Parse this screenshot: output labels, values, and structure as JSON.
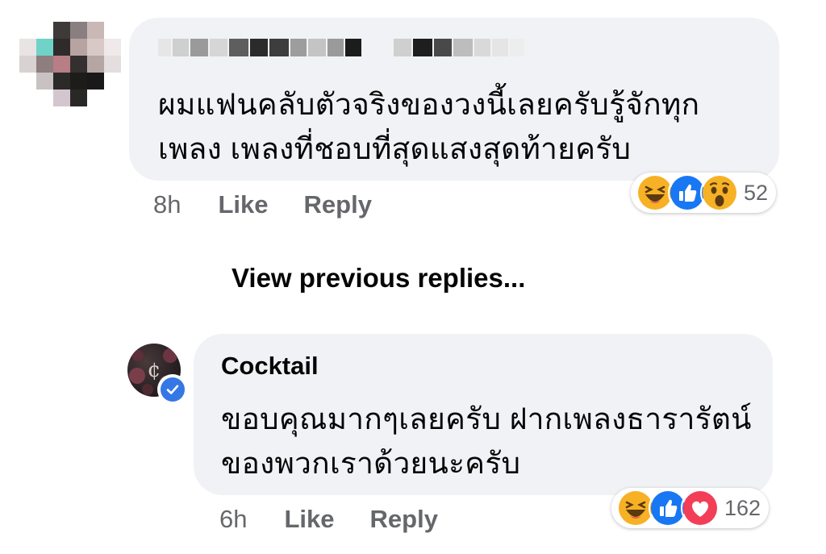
{
  "comment": {
    "text": "ผมแฟนคลับตัวจริงของวงนี้เลยครับรู้จักทุก เพลง เพลงที่ชอบที่สุดแสงสุดท้ายครับ",
    "time": "8h",
    "like_label": "Like",
    "reply_label": "Reply",
    "reactions": {
      "icons": [
        "haha-icon",
        "like-icon",
        "wow-icon"
      ],
      "count": "52"
    }
  },
  "view_previous_replies": "View previous replies...",
  "reply": {
    "author": "Cocktail",
    "verified": true,
    "text": "ขอบคุณมากๆเลยครับ ฝากเพลงธารารัตน์ของพวกเราด้วยนะครับ",
    "time": "6h",
    "like_label": "Like",
    "reply_label": "Reply",
    "reactions": {
      "icons": [
        "haha-icon",
        "like-icon",
        "love-icon"
      ],
      "count": "162"
    }
  },
  "colors": {
    "bubble": "#f0f2f5",
    "meta_text": "#65676b",
    "like_blue": "#1877f2",
    "love_red": "#f33e58",
    "emoji_yellow": "#f7b125",
    "verified_blue": "#3578e5"
  }
}
